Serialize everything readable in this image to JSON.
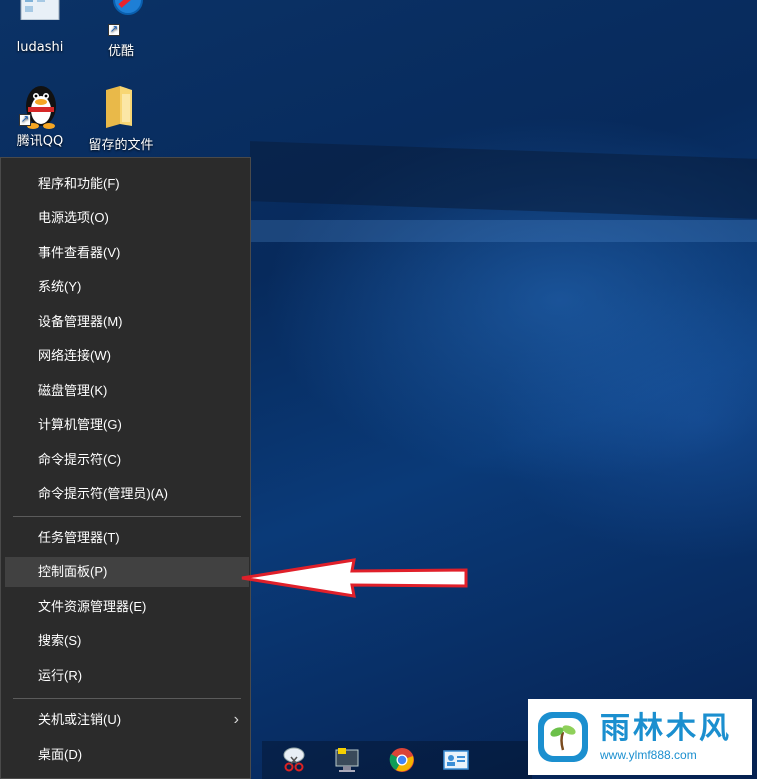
{
  "desktop_icons": [
    {
      "label": "ludashi",
      "icon": "ludashi-icon"
    },
    {
      "label": "优酷",
      "icon": "youku-icon"
    },
    {
      "label": "腾讯QQ",
      "icon": "qq-penguin-icon"
    },
    {
      "label": "留存的文件",
      "icon": "folder-icon"
    }
  ],
  "context_menu": {
    "items": [
      {
        "label": "程序和功能(F)"
      },
      {
        "label": "电源选项(O)"
      },
      {
        "label": "事件查看器(V)"
      },
      {
        "label": "系统(Y)"
      },
      {
        "label": "设备管理器(M)"
      },
      {
        "label": "网络连接(W)"
      },
      {
        "label": "磁盘管理(K)"
      },
      {
        "label": "计算机管理(G)"
      },
      {
        "label": "命令提示符(C)"
      },
      {
        "label": "命令提示符(管理员)(A)"
      },
      {
        "label": "任务管理器(T)"
      },
      {
        "label": "控制面板(P)",
        "highlighted": true
      },
      {
        "label": "文件资源管理器(E)"
      },
      {
        "label": "搜索(S)"
      },
      {
        "label": "运行(R)"
      },
      {
        "label": "关机或注销(U)",
        "submenu": true
      },
      {
        "label": "桌面(D)"
      }
    ],
    "submenu_arrow": "›"
  },
  "taskbar_icons": [
    "snipping-tool-icon",
    "monitor-app-icon",
    "chrome-icon",
    "contact-card-icon"
  ],
  "watermark": {
    "title": "雨林木风",
    "url": "www.ylmf888.com"
  },
  "colors": {
    "menu_bg": "#2b2b2b",
    "menu_highlight": "#414141",
    "annotation_arrow": "#e0202a",
    "watermark_blue": "#1b8fcf"
  }
}
